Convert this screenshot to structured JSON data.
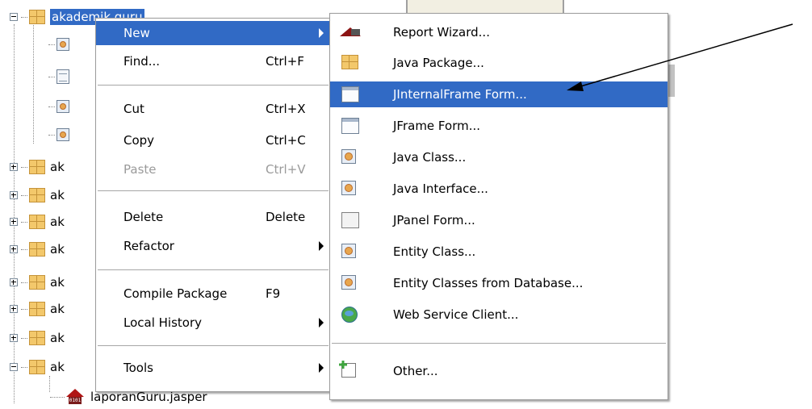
{
  "tree": {
    "selected_package": "akademik.guru",
    "collapsed_label": "ak",
    "file": "laporanGuru.jasper"
  },
  "context_menu": {
    "items": [
      {
        "label": "New",
        "shortcut": "",
        "submenu": true
      },
      {
        "label": "Find...",
        "shortcut": "Ctrl+F"
      },
      {
        "label": "Cut",
        "shortcut": "Ctrl+X"
      },
      {
        "label": "Copy",
        "shortcut": "Ctrl+C"
      },
      {
        "label": "Paste",
        "shortcut": "Ctrl+V",
        "disabled": true
      },
      {
        "label": "Delete",
        "shortcut": "Delete"
      },
      {
        "label": "Refactor",
        "submenu": true
      },
      {
        "label": "Compile Package",
        "shortcut": "F9"
      },
      {
        "label": "Local History",
        "submenu": true
      },
      {
        "label": "Tools",
        "submenu": true
      }
    ]
  },
  "new_submenu": {
    "items": [
      {
        "label": "Report Wizard...",
        "icon": "report-wizard-icon"
      },
      {
        "label": "Java Package...",
        "icon": "package-icon"
      },
      {
        "label": "JInternalFrame Form...",
        "icon": "internal-frame-icon"
      },
      {
        "label": "JFrame Form...",
        "icon": "frame-icon"
      },
      {
        "label": "Java Class...",
        "icon": "class-icon"
      },
      {
        "label": "Java Interface...",
        "icon": "interface-icon"
      },
      {
        "label": "JPanel Form...",
        "icon": "panel-icon"
      },
      {
        "label": "Entity Class...",
        "icon": "class-icon"
      },
      {
        "label": "Entity Classes from Database...",
        "icon": "class-icon"
      },
      {
        "label": "Web Service Client...",
        "icon": "globe-icon"
      },
      {
        "label": "Other...",
        "icon": "new-file-icon"
      }
    ]
  },
  "colors": {
    "selection": "#316ac5",
    "package": "#f3c86b",
    "arrow": "#000000"
  }
}
